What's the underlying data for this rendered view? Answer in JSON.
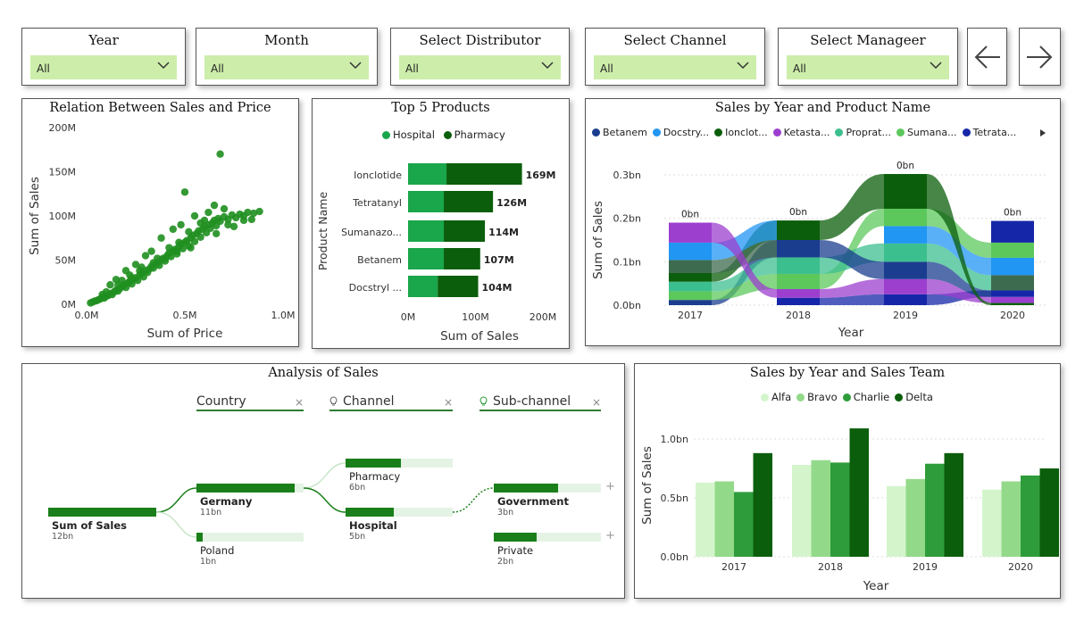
{
  "filters": [
    {
      "title": "Year",
      "value": "All"
    },
    {
      "title": "Month",
      "value": "All"
    },
    {
      "title": "Select Distributor",
      "value": "All"
    },
    {
      "title": "Select Channel",
      "value": "All"
    },
    {
      "title": "Select Manageer",
      "value": "All"
    }
  ],
  "nav": {
    "back_icon": "arrow-left-icon",
    "forward_icon": "arrow-right-icon"
  },
  "colors": {
    "green_dark": "#0b5e0b",
    "green_mid": "#1aa64b",
    "scatter": "#1f8f1f",
    "filter_bg": "#cdeeaa"
  },
  "scatter": {
    "title": "Relation Between Sales and Price",
    "chart_data": {
      "type": "scatter",
      "title": "Relation Between Sales and Price",
      "xlabel": "Sum of Price",
      "ylabel": "Sum of Sales",
      "xlim": [
        0,
        1000000
      ],
      "ylim": [
        0,
        200000000
      ],
      "x_ticks": [
        "0.0M",
        "0.5M",
        "1.0M"
      ],
      "y_ticks": [
        "0M",
        "50M",
        "100M",
        "150M",
        "200M"
      ],
      "points": [
        [
          0.02,
          1.5
        ],
        [
          0.03,
          2.5
        ],
        [
          0.04,
          3.5
        ],
        [
          0.05,
          4
        ],
        [
          0.06,
          5
        ],
        [
          0.07,
          6
        ],
        [
          0.08,
          8
        ],
        [
          0.09,
          7
        ],
        [
          0.1,
          9
        ],
        [
          0.11,
          10
        ],
        [
          0.12,
          12
        ],
        [
          0.13,
          11
        ],
        [
          0.14,
          14
        ],
        [
          0.15,
          16
        ],
        [
          0.16,
          15
        ],
        [
          0.17,
          18
        ],
        [
          0.18,
          20
        ],
        [
          0.19,
          22
        ],
        [
          0.2,
          19
        ],
        [
          0.21,
          24
        ],
        [
          0.22,
          26
        ],
        [
          0.23,
          23
        ],
        [
          0.24,
          28
        ],
        [
          0.25,
          30
        ],
        [
          0.26,
          27
        ],
        [
          0.27,
          33
        ],
        [
          0.28,
          35
        ],
        [
          0.29,
          31
        ],
        [
          0.3,
          38
        ],
        [
          0.31,
          36
        ],
        [
          0.32,
          40
        ],
        [
          0.33,
          43
        ],
        [
          0.34,
          41
        ],
        [
          0.35,
          45
        ],
        [
          0.36,
          47
        ],
        [
          0.37,
          44
        ],
        [
          0.38,
          50
        ],
        [
          0.39,
          52
        ],
        [
          0.4,
          49
        ],
        [
          0.41,
          55
        ],
        [
          0.42,
          58
        ],
        [
          0.43,
          54
        ],
        [
          0.44,
          60
        ],
        [
          0.45,
          62
        ],
        [
          0.46,
          57
        ],
        [
          0.47,
          65
        ],
        [
          0.48,
          68
        ],
        [
          0.49,
          63
        ],
        [
          0.5,
          70
        ],
        [
          0.51,
          72
        ],
        [
          0.52,
          66
        ],
        [
          0.53,
          75
        ],
        [
          0.54,
          78
        ],
        [
          0.55,
          71
        ],
        [
          0.56,
          80
        ],
        [
          0.57,
          83
        ],
        [
          0.58,
          76
        ],
        [
          0.59,
          85
        ],
        [
          0.6,
          88
        ],
        [
          0.61,
          81
        ],
        [
          0.62,
          90
        ],
        [
          0.63,
          86
        ],
        [
          0.64,
          92
        ],
        [
          0.65,
          95
        ],
        [
          0.66,
          89
        ],
        [
          0.67,
          97
        ],
        [
          0.68,
          94
        ],
        [
          0.7,
          99
        ],
        [
          0.72,
          96
        ],
        [
          0.74,
          101
        ],
        [
          0.76,
          98
        ],
        [
          0.78,
          102
        ],
        [
          0.8,
          100
        ],
        [
          0.82,
          104
        ],
        [
          0.85,
          103
        ],
        [
          0.88,
          105
        ],
        [
          0.68,
          170
        ],
        [
          0.5,
          127
        ],
        [
          0.65,
          112
        ],
        [
          0.7,
          108
        ],
        [
          0.55,
          100
        ],
        [
          0.6,
          95
        ],
        [
          0.48,
          90
        ],
        [
          0.44,
          85
        ],
        [
          0.38,
          75
        ],
        [
          0.33,
          60
        ],
        [
          0.3,
          55
        ],
        [
          0.25,
          45
        ],
        [
          0.2,
          38
        ],
        [
          0.15,
          28
        ],
        [
          0.12,
          22
        ],
        [
          0.52,
          82
        ],
        [
          0.58,
          92
        ],
        [
          0.62,
          104
        ],
        [
          0.47,
          70
        ],
        [
          0.42,
          64
        ],
        [
          0.36,
          52
        ],
        [
          0.28,
          42
        ],
        [
          0.22,
          33
        ],
        [
          0.18,
          27
        ],
        [
          0.72,
          90
        ],
        [
          0.75,
          88
        ],
        [
          0.8,
          95
        ],
        [
          0.84,
          96
        ],
        [
          0.66,
          80
        ],
        [
          0.53,
          64
        ],
        [
          0.46,
          60
        ],
        [
          0.4,
          52
        ],
        [
          0.34,
          47
        ],
        [
          0.27,
          38
        ],
        [
          0.23,
          30
        ],
        [
          0.16,
          22
        ],
        [
          0.1,
          14
        ],
        [
          0.08,
          11
        ]
      ]
    }
  },
  "top5": {
    "title": "Top 5 Products",
    "legend": [
      "Hospital",
      "Pharmacy"
    ],
    "chart_data": {
      "type": "bar",
      "orientation": "horizontal",
      "stacked": true,
      "title": "Top 5 Products",
      "xlabel": "Sum of Sales",
      "ylabel": "Product Name",
      "categories": [
        "Ionclotide",
        "Tetratanyl",
        "Sumanazo...",
        "Betanem",
        "Docstryl ..."
      ],
      "series": [
        {
          "name": "Hospital",
          "values": [
            57,
            53,
            53,
            53,
            44
          ]
        },
        {
          "name": "Pharmacy",
          "values": [
            112,
            73,
            61,
            54,
            60
          ]
        }
      ],
      "totals": [
        "169M",
        "126M",
        "114M",
        "107M",
        "104M"
      ],
      "x_ticks": [
        "0M",
        "100M",
        "200M"
      ],
      "xlim": [
        0,
        200
      ]
    }
  },
  "ribbon": {
    "title": "Sales by Year and Product Name",
    "legend": [
      {
        "name": "Betanem",
        "color": "#1b3d8f"
      },
      {
        "name": "Docstry...",
        "color": "#2196f3"
      },
      {
        "name": "Ionclot...",
        "color": "#0b5e0b"
      },
      {
        "name": "Ketasta...",
        "color": "#9c3fcf"
      },
      {
        "name": "Proprat...",
        "color": "#3cbf8f"
      },
      {
        "name": "Sumana...",
        "color": "#5cc85c"
      },
      {
        "name": "Tetrata...",
        "color": "#1527a8"
      }
    ],
    "chart_data": {
      "type": "area",
      "subtype": "ribbon",
      "title": "Sales by Year and Product Name",
      "xlabel": "Year",
      "ylabel": "Sum of Sales",
      "categories": [
        "2017",
        "2018",
        "2019",
        "2020"
      ],
      "y_ticks": [
        "0.0bn",
        "0.1bn",
        "0.2bn",
        "0.3bn"
      ],
      "ylim": [
        0,
        0.33
      ],
      "total_labels": [
        "0bn",
        "0bn",
        "0bn",
        "0bn"
      ],
      "stacks": [
        [
          {
            "color": "#1b3d8f",
            "h": 0.012
          },
          {
            "color": "#5cc85c",
            "h": 0.02
          },
          {
            "color": "#3cbf8f",
            "h": 0.022
          },
          {
            "color": "#0b5e0b",
            "h": 0.02
          },
          {
            "color": "#3d6b4f",
            "h": 0.03
          },
          {
            "color": "#2196f3",
            "h": 0.04
          },
          {
            "color": "#9c3fcf",
            "h": 0.046
          }
        ],
        [
          {
            "color": "#1527a8",
            "h": 0.017
          },
          {
            "color": "#9c3fcf",
            "h": 0.02
          },
          {
            "color": "#5cc85c",
            "h": 0.035
          },
          {
            "color": "#3cbf8f",
            "h": 0.038
          },
          {
            "color": "#1b3d8f",
            "h": 0.04
          },
          {
            "color": "#0b5e0b",
            "h": 0.045
          }
        ],
        [
          {
            "color": "#1527a8",
            "h": 0.025
          },
          {
            "color": "#9c3fcf",
            "h": 0.035
          },
          {
            "color": "#1b3d8f",
            "h": 0.04
          },
          {
            "color": "#3cbf8f",
            "h": 0.042
          },
          {
            "color": "#2196f3",
            "h": 0.04
          },
          {
            "color": "#5cc85c",
            "h": 0.04
          },
          {
            "color": "#0b5e0b",
            "h": 0.08
          }
        ],
        [
          {
            "color": "#0b5e0b",
            "h": 0.005
          },
          {
            "color": "#9c3fcf",
            "h": 0.014
          },
          {
            "color": "#1527a8",
            "h": 0.015
          },
          {
            "color": "#3d6b4f",
            "h": 0.035
          },
          {
            "color": "#2196f3",
            "h": 0.04
          },
          {
            "color": "#5cc85c",
            "h": 0.035
          },
          {
            "color": "#1527a8",
            "h": 0.05
          }
        ]
      ]
    }
  },
  "decomp": {
    "title": "Analysis of Sales",
    "levels": [
      {
        "label": "Country",
        "close": "×"
      },
      {
        "label": "Channel",
        "close": "×"
      },
      {
        "label": "Sub-channel",
        "close": "×"
      }
    ],
    "root": {
      "label": "Sum of Sales",
      "value": "12bn"
    },
    "countries": [
      {
        "label": "Germany",
        "value": "11bn",
        "fill": 0.92
      },
      {
        "label": "Poland",
        "value": "1bn",
        "fill": 0.06
      }
    ],
    "channels": [
      {
        "label": "Pharmacy",
        "value": "6bn",
        "fill": 0.52
      },
      {
        "label": "Hospital",
        "value": "5bn",
        "fill": 0.45
      }
    ],
    "subchannels": [
      {
        "label": "Government",
        "value": "3bn",
        "fill": 0.6
      },
      {
        "label": "Private",
        "value": "2bn",
        "fill": 0.4
      }
    ],
    "plus": "+"
  },
  "team": {
    "title": "Sales by Year and Sales Team",
    "legend": [
      {
        "name": "Alfa",
        "color": "#d4f5cc"
      },
      {
        "name": "Bravo",
        "color": "#93d98a"
      },
      {
        "name": "Charlie",
        "color": "#2e9c3a"
      },
      {
        "name": "Delta",
        "color": "#0b5e0b"
      }
    ],
    "chart_data": {
      "type": "bar",
      "title": "Sales by Year and Sales Team",
      "xlabel": "Year",
      "ylabel": "Sum of Sales",
      "categories": [
        "2017",
        "2018",
        "2019",
        "2020"
      ],
      "series": [
        {
          "name": "Alfa",
          "values": [
            0.63,
            0.78,
            0.6,
            0.57
          ]
        },
        {
          "name": "Bravo",
          "values": [
            0.64,
            0.82,
            0.66,
            0.64
          ]
        },
        {
          "name": "Charlie",
          "values": [
            0.55,
            0.8,
            0.79,
            0.69
          ]
        },
        {
          "name": "Delta",
          "values": [
            0.88,
            1.09,
            0.88,
            0.75
          ]
        }
      ],
      "y_ticks": [
        "0.0bn",
        "0.5bn",
        "1.0bn"
      ],
      "ylim": [
        0,
        1.15
      ]
    }
  }
}
